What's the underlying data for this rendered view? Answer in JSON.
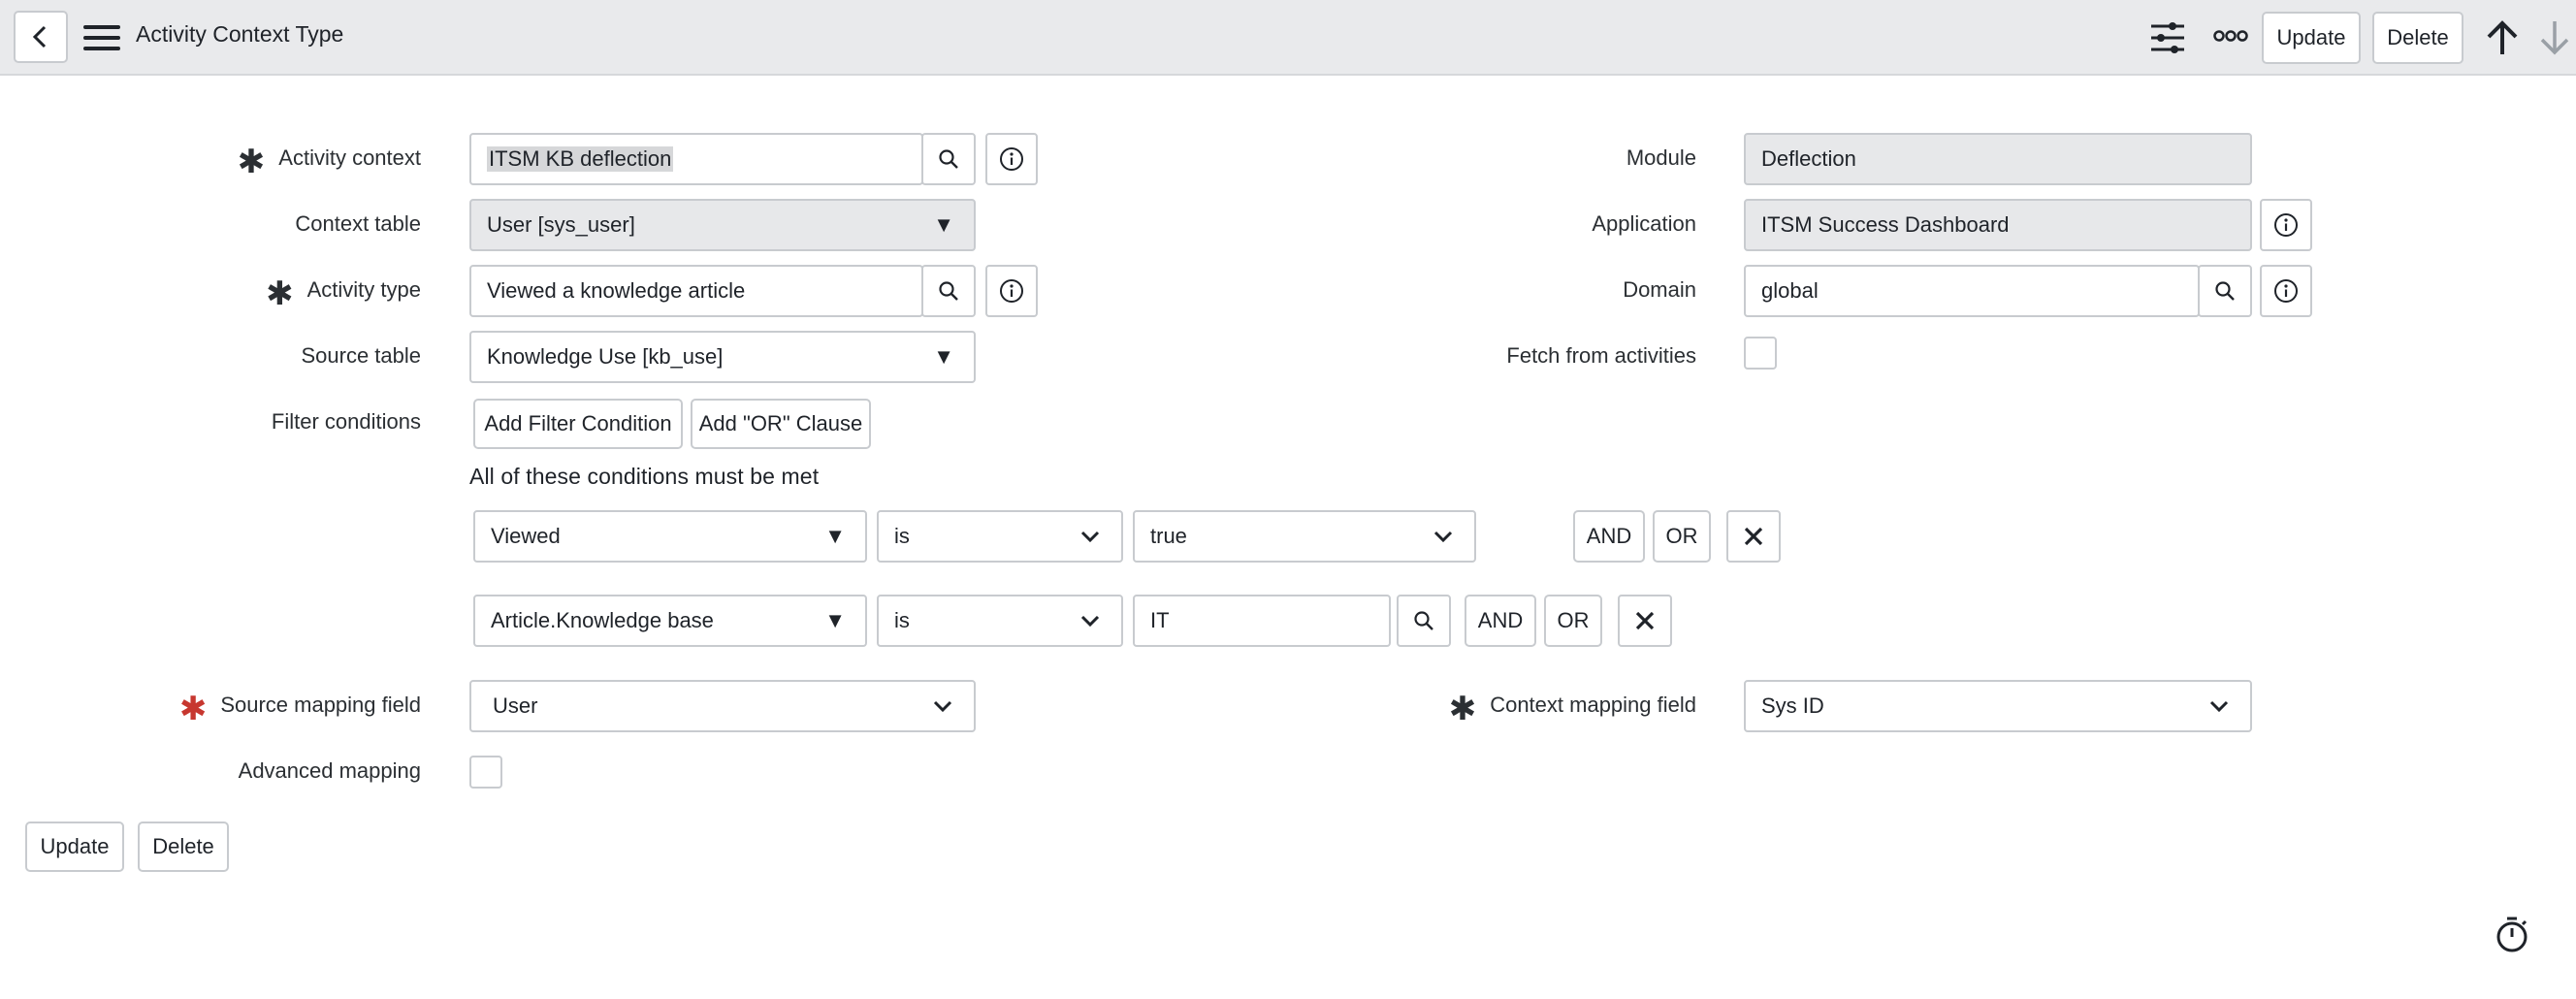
{
  "header": {
    "title": "Activity Context Type",
    "update_label": "Update",
    "delete_label": "Delete",
    "icons": [
      "back-icon",
      "hamburger-menu-icon",
      "sliders-icon",
      "more-options-icon",
      "arrow-up-icon",
      "arrow-down-icon"
    ]
  },
  "form": {
    "activity_context": {
      "label": "Activity context",
      "value": "ITSM KB deflection",
      "required": true
    },
    "context_table": {
      "label": "Context table",
      "value": "User [sys_user]"
    },
    "activity_type": {
      "label": "Activity type",
      "value": "Viewed a knowledge article",
      "required": true
    },
    "source_table": {
      "label": "Source table",
      "value": "Knowledge Use [kb_use]"
    },
    "filter_conditions": {
      "label": "Filter conditions",
      "add_filter_label": "Add Filter Condition",
      "add_or_label": "Add \"OR\" Clause",
      "title": "All of these conditions must be met",
      "rows": [
        {
          "field": "Viewed",
          "operator": "is",
          "value": "true",
          "and_label": "AND",
          "or_label": "OR"
        },
        {
          "field": "Article.Knowledge base",
          "operator": "is",
          "value": "IT",
          "and_label": "AND",
          "or_label": "OR"
        }
      ]
    },
    "source_mapping_field": {
      "label": "Source mapping field",
      "value": "User",
      "required": true,
      "required_color": "#c7372f"
    },
    "advanced_mapping": {
      "label": "Advanced mapping",
      "checked": false
    },
    "module": {
      "label": "Module",
      "value": "Deflection"
    },
    "application": {
      "label": "Application",
      "value": "ITSM Success Dashboard"
    },
    "domain": {
      "label": "Domain",
      "value": "global"
    },
    "fetch_from_activities": {
      "label": "Fetch from activities",
      "checked": false
    },
    "context_mapping_field": {
      "label": "Context mapping field",
      "value": "Sys ID",
      "required": true
    }
  },
  "footer": {
    "update_label": "Update",
    "delete_label": "Delete"
  },
  "colors": {
    "header_bg": "#e9eaec",
    "readonly_bg": "#e7e8ea",
    "required_red": "#c7372f"
  }
}
